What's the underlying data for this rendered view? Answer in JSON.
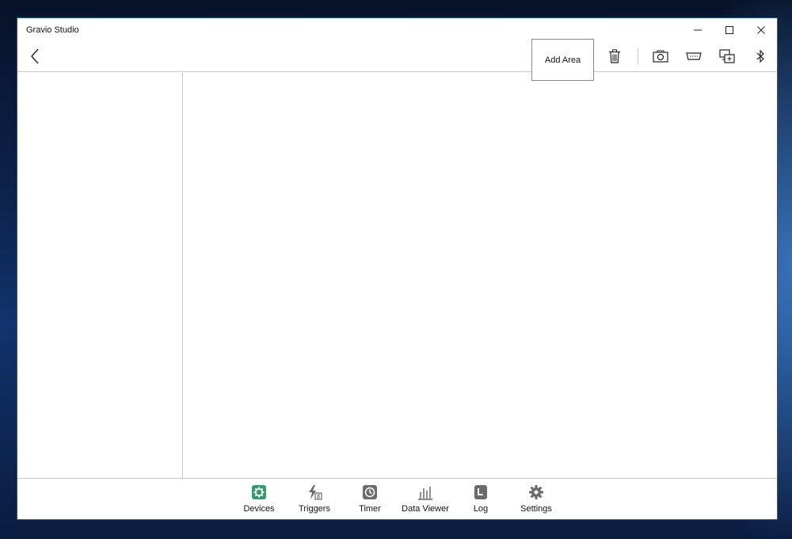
{
  "window": {
    "title": "Gravio Studio"
  },
  "titlebar_controls": {
    "minimize": "–",
    "maximize": "☐",
    "close": "✕"
  },
  "toolbar": {
    "add_area_tooltip": "Add Area"
  },
  "bottom_nav": {
    "items": [
      {
        "label": "Devices",
        "icon": "devices-icon",
        "active": true
      },
      {
        "label": "Triggers",
        "icon": "triggers-icon",
        "active": false
      },
      {
        "label": "Timer",
        "icon": "timer-icon",
        "active": false
      },
      {
        "label": "Data Viewer",
        "icon": "data-viewer-icon",
        "active": false
      },
      {
        "label": "Log",
        "icon": "log-icon",
        "active": false
      },
      {
        "label": "Settings",
        "icon": "settings-icon",
        "active": false
      }
    ]
  },
  "colors": {
    "accent_active": "#2e9e6a",
    "icon_inactive": "#6b6b6b",
    "window_border": "#1e5aa8"
  }
}
